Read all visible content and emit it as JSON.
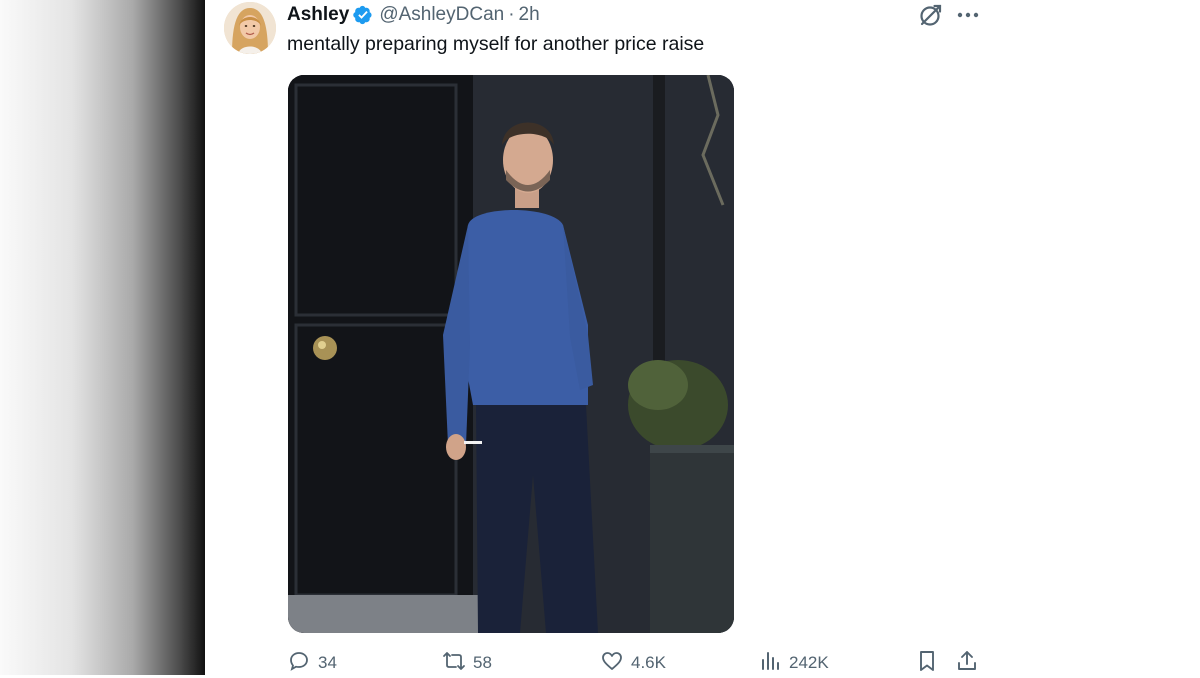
{
  "tweet": {
    "author_name": "Ashley",
    "handle": "@AshleyDCan",
    "separator": "·",
    "time": "2h",
    "text": "mentally preparing myself for another price raise",
    "verified_color": "#1d9bf0",
    "media_description_icon": "photo"
  },
  "actions": {
    "replies": "34",
    "reposts": "58",
    "likes": "4.6K",
    "views": "242K"
  },
  "icons": {
    "grok": "grok-icon",
    "more": "more-icon",
    "reply": "reply-icon",
    "repost": "repost-icon",
    "like": "heart-icon",
    "views": "analytics-icon",
    "bookmark": "bookmark-icon",
    "share": "share-icon"
  },
  "colors": {
    "text_primary": "#0f1419",
    "text_secondary": "#536471",
    "accent": "#1d9bf0"
  }
}
